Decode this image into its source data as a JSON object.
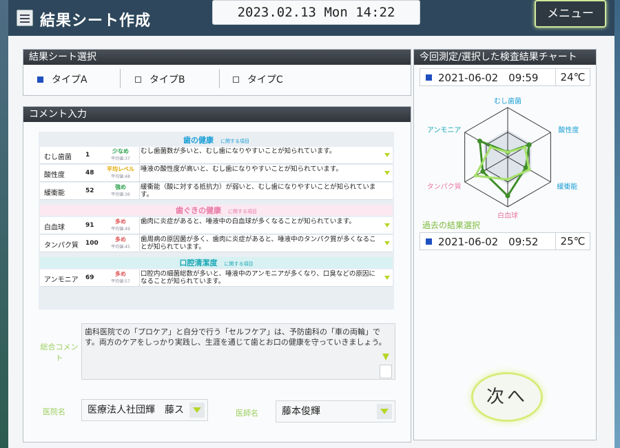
{
  "app": {
    "title": "結果シート作成",
    "datetime": "2023.02.13 Mon 14:22",
    "menu_label": "メニュー"
  },
  "type_select": {
    "heading": "結果シート選択",
    "options": [
      {
        "label": "タイプA",
        "checked": true
      },
      {
        "label": "タイプB",
        "checked": false
      },
      {
        "label": "タイプC",
        "checked": false
      }
    ]
  },
  "comment": {
    "heading": "コメント入力",
    "categories": [
      {
        "title": "歯の健康",
        "suffix": "に関する項目",
        "color": "#1a9fd6",
        "rows": [
          {
            "name": "むし歯菌",
            "value": "1",
            "level": "少なめ",
            "level_color": "#2aa04a",
            "avg": "平均値:37",
            "text": "むし歯菌数が多いと、むし歯になりやすいことが知られています。"
          },
          {
            "name": "酸性度",
            "value": "48",
            "level": "平均レベル",
            "level_color": "#e0a800",
            "avg": "平均値:48",
            "text": "唾液の酸性度が高いと、むし歯になりやすいことが知られています。"
          },
          {
            "name": "緩衝能",
            "value": "52",
            "level": "強め",
            "level_color": "#2aa04a",
            "avg": "平均値:36",
            "text": "緩衝能（酸に対する抵抗力）が弱いと、むし歯になりやすいことが知られています。"
          }
        ]
      },
      {
        "title": "歯ぐきの健康",
        "suffix": "に関する項目",
        "color": "#e87aa6",
        "rows": [
          {
            "name": "白血球",
            "value": "91",
            "level": "多め",
            "level_color": "#e05555",
            "avg": "平均値:49",
            "text": "歯肉に炎症があると、唾液中の白血球が多くなることが知られています。"
          },
          {
            "name": "タンパク質",
            "value": "100",
            "level": "多め",
            "level_color": "#e05555",
            "avg": "平均値:45",
            "text": "歯周病の原因菌が多く、歯肉に炎症があると、唾液中のタンパク質が多くなることが知られています。"
          }
        ]
      },
      {
        "title": "口腔清潔度",
        "suffix": "に関する項目",
        "color": "#1aa7b5",
        "rows": [
          {
            "name": "アンモニア",
            "value": "69",
            "level": "多め",
            "level_color": "#e05555",
            "avg": "平均値:57",
            "text": "口腔内の細菌総数が多いと、唾液中のアンモニアが多くなり、口臭などの原因になることが知られています。"
          }
        ]
      }
    ]
  },
  "total_comment": {
    "label": "総合コメント",
    "text": "歯科医院での「プロケア」と自分で行う「セルフケア」は、予防歯科の「車の両輪」です。両方のケアをしっかり実践し、生涯を通じて歯とお口の健康を守っていきましょう。"
  },
  "clinic": {
    "label": "医院名",
    "value": "医療法人社団輝　藤ス"
  },
  "doctor": {
    "label": "医師名",
    "value": "藤本俊輝"
  },
  "chart_panel": {
    "heading": "今回測定/選択した検査結果チャート",
    "current": {
      "date": "2021-06-02　09:59",
      "temp": "24℃"
    },
    "past_label": "過去の結果選択",
    "past": {
      "date": "2021-06-02　09:52",
      "temp": "25℃"
    }
  },
  "chart_data": {
    "type": "radar",
    "axes": [
      "むし歯菌",
      "酸性度",
      "緩衝能",
      "白血球",
      "タンパク質",
      "アンモニア"
    ],
    "axis_label_colors": [
      "#1a9fd6",
      "#1a9fd6",
      "#1a9fd6",
      "#e87aa6",
      "#e87aa6",
      "#1aa7b5"
    ],
    "rmax": 1,
    "series": [
      {
        "color": "#3f8f2a",
        "values": [
          0.1,
          0.5,
          0.42,
          0.78,
          0.58,
          0.65
        ]
      },
      {
        "color": "#a6e06a",
        "values": [
          0.1,
          0.4,
          0.5,
          0.45,
          0.75,
          0.4
        ]
      }
    ]
  },
  "next_label": "次へ"
}
